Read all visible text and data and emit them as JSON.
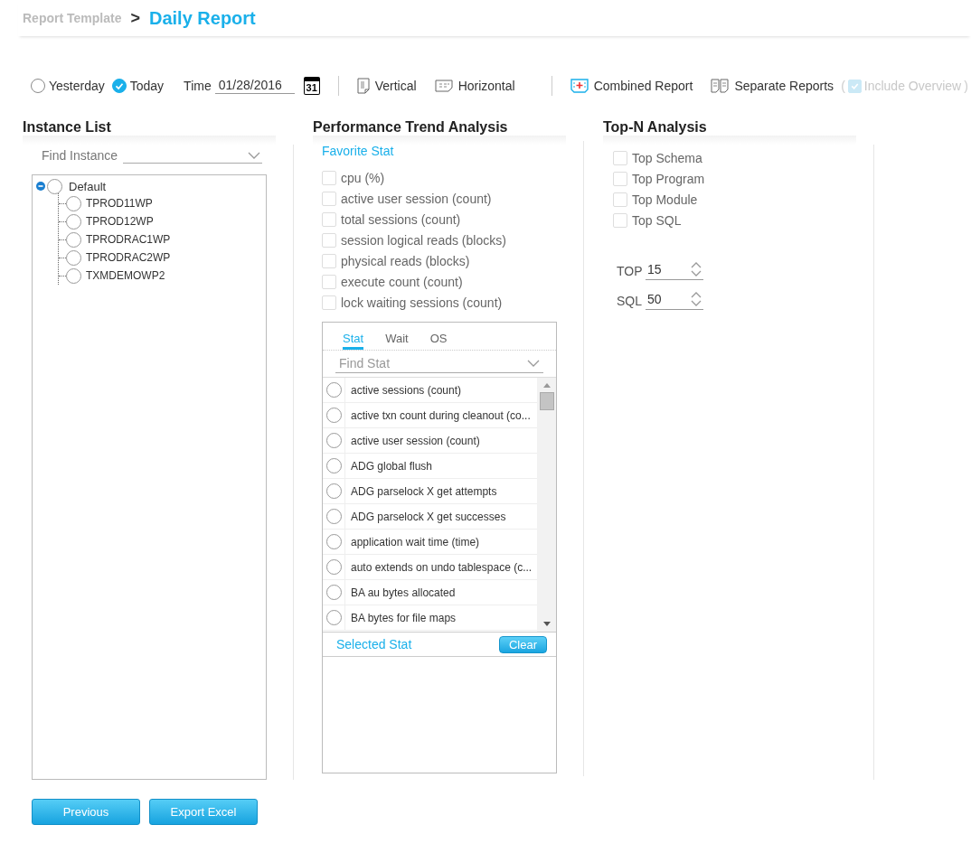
{
  "breadcrumb": {
    "parent": "Report Template",
    "separator": ">",
    "current": "Daily Report"
  },
  "toolbar": {
    "date_options": [
      {
        "label": "Yesterday",
        "selected": false
      },
      {
        "label": "Today",
        "selected": true
      }
    ],
    "time_label": "Time",
    "time_value": "01/28/2016",
    "calendar_day": "31",
    "layout_buttons": [
      {
        "label": "Vertical",
        "kind": "vertical"
      },
      {
        "label": "Horizontal",
        "kind": "horizontal"
      }
    ],
    "report_buttons": [
      {
        "label": "Combined Report",
        "kind": "combined"
      },
      {
        "label": "Separate Reports",
        "kind": "separate"
      }
    ],
    "include_overview": {
      "open": "(",
      "label": "Include Overview",
      "close": ")",
      "checked": true,
      "disabled": true
    }
  },
  "instance_list": {
    "title": "Instance List",
    "find_label": "Find Instance",
    "tree": {
      "label": "Default",
      "expanded": true,
      "selected": false,
      "children": [
        {
          "label": "TPROD11WP",
          "selected": false
        },
        {
          "label": "TPROD12WP",
          "selected": false
        },
        {
          "label": "TPRODRAC1WP",
          "selected": false
        },
        {
          "label": "TPRODRAC2WP",
          "selected": false
        },
        {
          "label": "TXMDEMOWP2",
          "selected": false
        }
      ]
    }
  },
  "trend": {
    "title": "Performance Trend Analysis",
    "favorite_title": "Favorite Stat",
    "favorites": [
      {
        "label": "cpu (%)",
        "checked": false
      },
      {
        "label": "active user session (count)",
        "checked": false
      },
      {
        "label": "total sessions (count)",
        "checked": false
      },
      {
        "label": "session logical reads (blocks)",
        "checked": false
      },
      {
        "label": "physical reads (blocks)",
        "checked": false
      },
      {
        "label": "execute count (count)",
        "checked": false
      },
      {
        "label": "lock waiting sessions (count)",
        "checked": false
      }
    ],
    "tabs": [
      {
        "label": "Stat",
        "selected": true
      },
      {
        "label": "Wait",
        "selected": false
      },
      {
        "label": "OS",
        "selected": false
      }
    ],
    "find_placeholder": "Find Stat",
    "stats": [
      {
        "label": "active sessions (count)",
        "selected": false
      },
      {
        "label": "active txn count during cleanout (co...",
        "selected": false
      },
      {
        "label": "active user session (count)",
        "selected": false
      },
      {
        "label": "ADG global flush",
        "selected": false
      },
      {
        "label": "ADG parselock X get attempts",
        "selected": false
      },
      {
        "label": "ADG parselock X get successes",
        "selected": false
      },
      {
        "label": "application wait time (time)",
        "selected": false
      },
      {
        "label": "auto extends on undo tablespace (c...",
        "selected": false
      },
      {
        "label": "BA au bytes allocated",
        "selected": false
      },
      {
        "label": "BA bytes for file maps",
        "selected": false
      }
    ],
    "selected_title": "Selected Stat",
    "clear_button": "Clear"
  },
  "topn": {
    "title": "Top-N Analysis",
    "options": [
      {
        "label": "Top Schema",
        "checked": false
      },
      {
        "label": "Top Program",
        "checked": false
      },
      {
        "label": "Top Module",
        "checked": false
      },
      {
        "label": "Top SQL",
        "checked": false
      }
    ],
    "spinners": [
      {
        "label": "TOP",
        "value": "15"
      },
      {
        "label": "SQL",
        "value": "50"
      }
    ]
  },
  "buttons": [
    "Previous",
    "Export Excel"
  ]
}
